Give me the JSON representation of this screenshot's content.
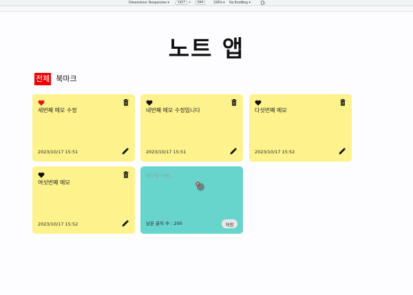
{
  "devtools": {
    "dimensions": "Dimensions: Responsive ▾",
    "width": "1427",
    "times": "×",
    "height": "844",
    "zoom": "100% ▾",
    "throttle": "No throttling ▾"
  },
  "app": {
    "title": "노트 앱"
  },
  "tabs": [
    {
      "label": "전체",
      "active": true
    },
    {
      "label": "북마크",
      "active": false
    }
  ],
  "notes": [
    {
      "text": "세번째 메모 수정",
      "date": "2023/10/17 15:51",
      "bookmarked": true
    },
    {
      "text": "네번째 메모 수정입니다",
      "date": "2023/10/17 15:51",
      "bookmarked": false
    },
    {
      "text": "다섯번째 메모",
      "date": "2023/10/17 15:52",
      "bookmarked": false
    },
    {
      "text": "여섯번째 메모",
      "date": "2023/10/17 15:52",
      "bookmarked": false
    }
  ],
  "new_note": {
    "placeholder": "메모할 내용...",
    "remaining": "남은 글자 수 : 200",
    "save_label": "저장"
  },
  "colors": {
    "note_bg": "#fdf28b",
    "new_note_bg": "#67d5cc",
    "active_tab": "#f00000",
    "heart_active": "#e0141a",
    "heart_inactive": "#111111"
  }
}
